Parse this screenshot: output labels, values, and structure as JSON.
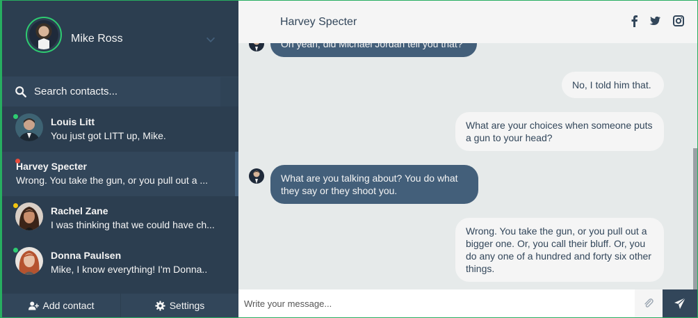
{
  "profile": {
    "name": "Mike Ross"
  },
  "search": {
    "placeholder": "Search contacts..."
  },
  "contacts": [
    {
      "name": "Louis Litt",
      "preview": "You just got LITT up, Mike.",
      "status_color": "#2ecc71"
    },
    {
      "name": "Harvey Specter",
      "preview": "Wrong. You take the gun, or you pull out a ...",
      "status_color": "#e74c3c"
    },
    {
      "name": "Rachel Zane",
      "preview": "I was thinking that we could have ch...",
      "status_color": "#f1c40f"
    },
    {
      "name": "Donna Paulsen",
      "preview": "Mike, I know everything! I'm Donna..",
      "status_color": "#2ecc71"
    }
  ],
  "sidebar_buttons": {
    "add_contact": "Add contact",
    "settings": "Settings"
  },
  "chat": {
    "contact_name": "Harvey Specter",
    "messages": [
      {
        "type": "sent",
        "text": "Oh yeah, did Michael Jordan tell you that?"
      },
      {
        "type": "reply",
        "text": "No, I told him that."
      },
      {
        "type": "reply",
        "text": "What are your choices when someone puts a gun to your head?"
      },
      {
        "type": "sent",
        "text": "What are you talking about? You do what they say or they shoot you."
      },
      {
        "type": "reply",
        "text": "Wrong. You take the gun, or you pull out a bigger one. Or, you call their bluff. Or, you do any one of a hundred and forty six other things."
      }
    ],
    "input_placeholder": "Write your message..."
  },
  "colors": {
    "accent": "#2ecc71",
    "sidebar": "#2c3e50",
    "bubble_sent": "#435f7a",
    "bubble_reply": "#f5f5f5"
  }
}
